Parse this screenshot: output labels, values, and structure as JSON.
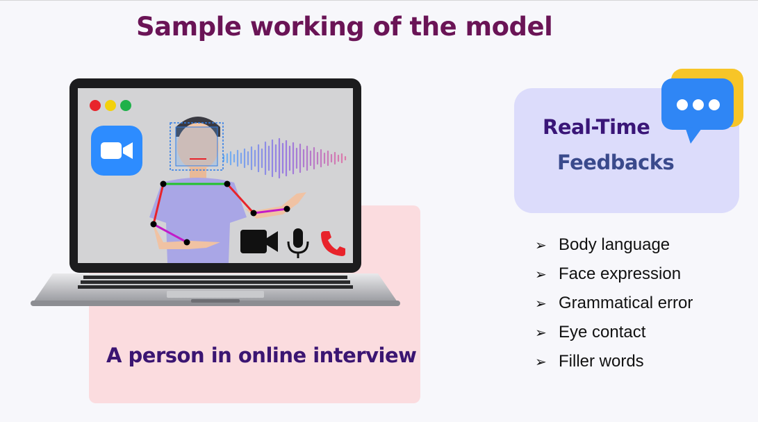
{
  "title": "Sample working of the model",
  "interview_label": "A person in online interview",
  "feedback": {
    "line1": "Real-Time",
    "line2": "Feedbacks"
  },
  "bullet_glyph": "➢",
  "features": [
    "Body language",
    "Face expression",
    "Grammatical error",
    "Eye contact",
    "Filler words"
  ],
  "colors": {
    "title": "#6a1456",
    "accent_text": "#3b1572",
    "pink_panel": "#fbdcdf",
    "feedback_panel": "#dcdcfb",
    "zoom_blue": "#2d8cff",
    "call_red": "#e8232b"
  },
  "icons": [
    "video-camera-icon",
    "microphone-icon",
    "phone-icon",
    "zoom-logo-icon",
    "chat-bubble-icon"
  ]
}
